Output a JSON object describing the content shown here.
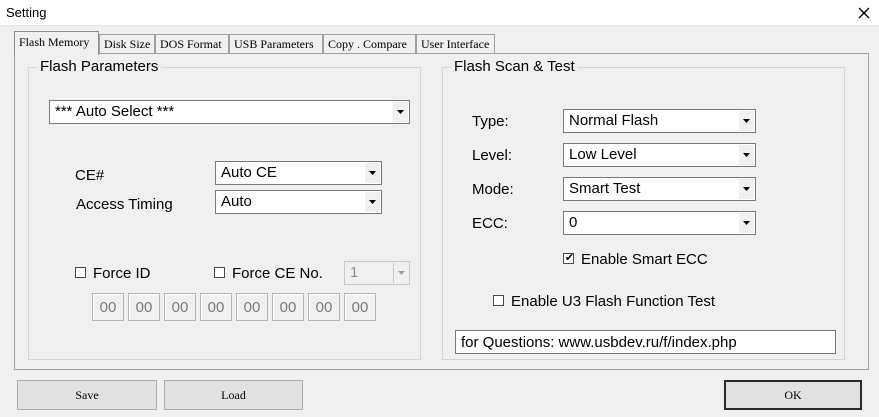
{
  "window": {
    "title": "Setting"
  },
  "tabs": [
    "Flash Memory",
    "Disk Size",
    "DOS Format",
    "USB Parameters",
    "Copy . Compare",
    "User Interface"
  ],
  "flash_parameters": {
    "group_label": "Flash Parameters",
    "select_value": "*** Auto Select ***",
    "ce_label": "CE#",
    "ce_value": "Auto CE",
    "access_timing_label": "Access Timing",
    "access_timing_value": "Auto",
    "force_id_label": "Force ID",
    "force_id_checked": false,
    "force_ce_label": "Force CE No.",
    "force_ce_checked": false,
    "force_ce_value": "1",
    "id_bytes": [
      "00",
      "00",
      "00",
      "00",
      "00",
      "00",
      "00",
      "00"
    ]
  },
  "flash_scan": {
    "group_label": "Flash Scan & Test",
    "type_label": "Type:",
    "type_value": "Normal Flash",
    "level_label": "Level:",
    "level_value": "Low Level",
    "mode_label": "Mode:",
    "mode_value": "Smart Test",
    "ecc_label": "ECC:",
    "ecc_value": "0",
    "smart_ecc_label": "Enable Smart ECC",
    "smart_ecc_checked": true,
    "u3_label": "Enable U3 Flash Function Test",
    "u3_checked": false,
    "questions_text": "for Questions: www.usbdev.ru/f/index.php"
  },
  "buttons": {
    "save": "Save",
    "load": "Load",
    "ok": "OK"
  },
  "icons": {
    "close": "close-icon",
    "dropdown": "chevron-down-icon",
    "check": "checkmark-icon"
  }
}
